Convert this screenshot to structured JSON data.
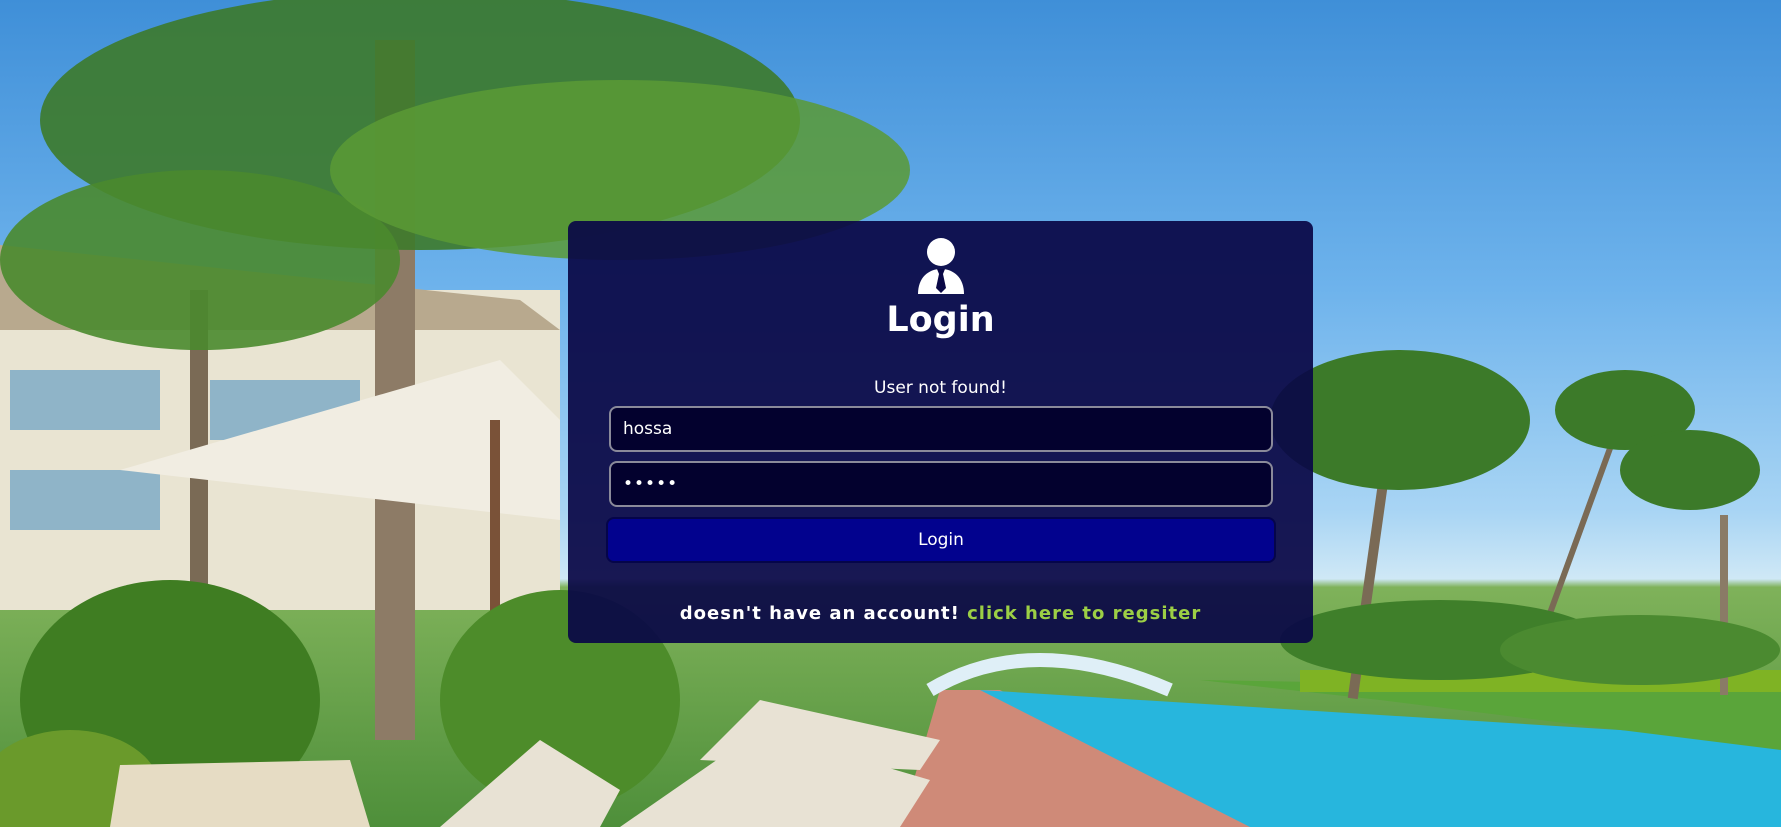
{
  "login": {
    "title": "Login",
    "error_message": "User not found!",
    "username_value": "hossa",
    "password_value": "hossa",
    "submit_label": "Login",
    "register_prompt": "doesn't have an account!",
    "register_link": "click here to regsiter"
  },
  "icons": {
    "avatar": "user-tie-icon"
  },
  "colors": {
    "panel": "#0a0846",
    "field_bg": "#03012e",
    "button_bg": "#02028e",
    "link": "#9ccf45",
    "text": "#ffffff"
  }
}
